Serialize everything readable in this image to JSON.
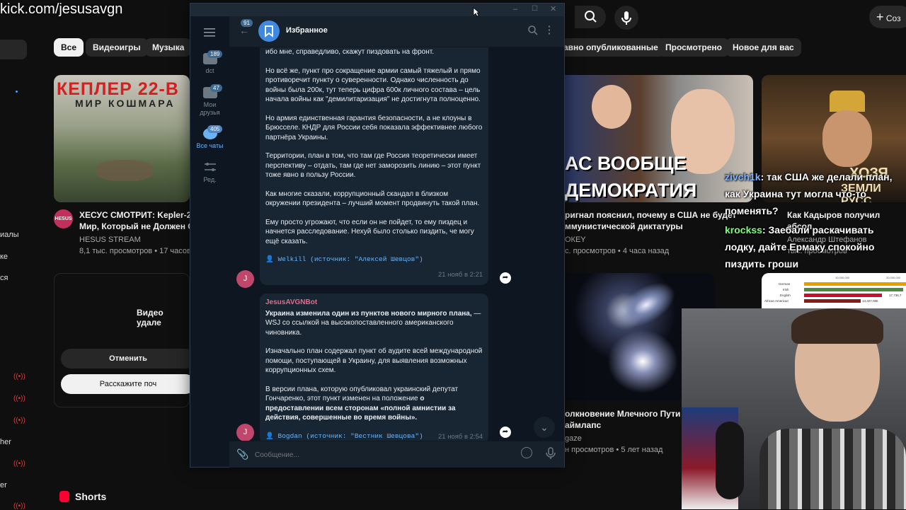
{
  "stream_overlay": {
    "url": "kick.com/jesusavgn"
  },
  "youtube": {
    "chips": [
      "Все",
      "Видеоигры",
      "Музыка",
      "Недавно опубликованные",
      "Просмотрено",
      "Новое для вас"
    ],
    "chip_partial_left": "авно опубликованные",
    "create_label": "Соз",
    "left_partial_items": [
      "иалы",
      "ке",
      "ся",
      "her",
      "er"
    ],
    "videos": [
      {
        "thumb_text_top": "КЕПЛЕР 22-В",
        "thumb_text_bottom": "МИР КОШМАРА",
        "channel_avatar": "HESUS",
        "title_line1": "ХЕСУС СМОТРИТ: Kepler-22",
        "title_line2": "Мир, Который не Должен С",
        "channel": "HESUS STREAM",
        "meta": "8,1 тыс. просмотров • 17 часов"
      },
      {
        "thumb_text_top": "АС ВООБЩЕ",
        "thumb_text_bottom": "ДЕМОКРАТИЯ",
        "title_line1": "ригнал пояснил, почему в США не будет",
        "title_line2": "ммунистической диктатуры",
        "channel": "ОКЕY",
        "meta": "с. просмотров • 4 часа назад"
      },
      {
        "thumb_text_top": "ХОЗЯ",
        "thumb_text_bottom": "ЗЕМЛИ РУСС",
        "title_line1": "Как Кадыров получил абсол",
        "channel": "Александр Штефанов",
        "meta": "тыс. просмотров"
      },
      {
        "title_line1": "олкновение Млечного Пути и",
        "title_line2": "аймлапс",
        "channel": "gaze",
        "meta": "н просмотров • 5 лет назад"
      }
    ],
    "removed_video": {
      "text": "Видео удале",
      "undo": "Отменить",
      "tell": "Расскажите поч"
    },
    "shorts_label": "Shorts",
    "chart_thumb_labels": [
      "German",
      "Irish",
      "English",
      "African American"
    ],
    "chart_thumb_numbers": [
      "10,000,000",
      "20,000,000",
      "17,736,7",
      "13,327,085"
    ]
  },
  "telegram": {
    "chat_title": "Избранное",
    "back_badge": "91",
    "folders": [
      {
        "label": "dct",
        "badge": "189"
      },
      {
        "label": "Мои друзья",
        "badge": "47"
      },
      {
        "label": "Все чаты",
        "badge": "405"
      },
      {
        "label": "Ред.",
        "badge": ""
      }
    ],
    "message1": {
      "paragraphs": [
        "ибо мне, справедливо, скажут пиздовать на фронт.",
        "Но всё же, пункт про сокращение армии самый тяжелый и прямо противоречит пункту о суверенности. Однако численность до войны была 200к, тут теперь цифра 600к личного состава – цель начала войны как \"демилитаризация\" не достигнута полноценно.",
        "Но армия единственная гарантия безопасности, а не клоуны в Брюсселе. КНДР для России себя показала эффективнее любого партнёра Украины.",
        "Территории, план в том, что там где Россия теоретически имеет перспективу – отдать, там где нет заморозить линию – этот пункт тоже явно в пользу России.",
        "Как многие сказали, коррупционный скандал в близком окружении президента – лучший момент продвинуть такой план.",
        "Ему просто угрожают, что если он не пойдет, то ему пиздец и начнется расследование. Нехуй было столько пиздить, че могу ещё сказать."
      ],
      "source": "👤 Welkill (источник: \"Алексей Шевцов\")",
      "time": "21 нояб в 2:21",
      "avatar": "J"
    },
    "message2": {
      "sender": "JesusAVGNBot",
      "headline": "Украина изменила один из пунктов нового мирного плана,",
      "headline_rest": " — WSJ со ссылкой на высокопоставленного американского чиновника.",
      "p2": "Изначально план содержал пункт об аудите всей международной помощи, поступающей в Украину, для выявления возможных коррупционных схем.",
      "p3_start": "В версии плана, которую опубликовал украинский депутат Гончаренко, этот пункт изменен на положение ",
      "p3_bold": "о предоставлении всем сторонам «полной амнистии за действия, совершенные во время войны».",
      "source": "👤 Bogdan (источник: \"Вестник Шевцова\")",
      "time": "21 нояб в 2:54",
      "avatar": "J"
    },
    "input_placeholder": "Сообщение..."
  },
  "stream_chat": [
    {
      "user": "zivch1k",
      "color": "#7fb3ff",
      "text": ": так США же делали план, как Украина тут могла что-то поменять?"
    },
    {
      "user": "krockss",
      "color": "#7dff7d",
      "text": ": Заебали раскачивать лодку, дайте Ермаку спокойно пиздить гроши"
    }
  ]
}
